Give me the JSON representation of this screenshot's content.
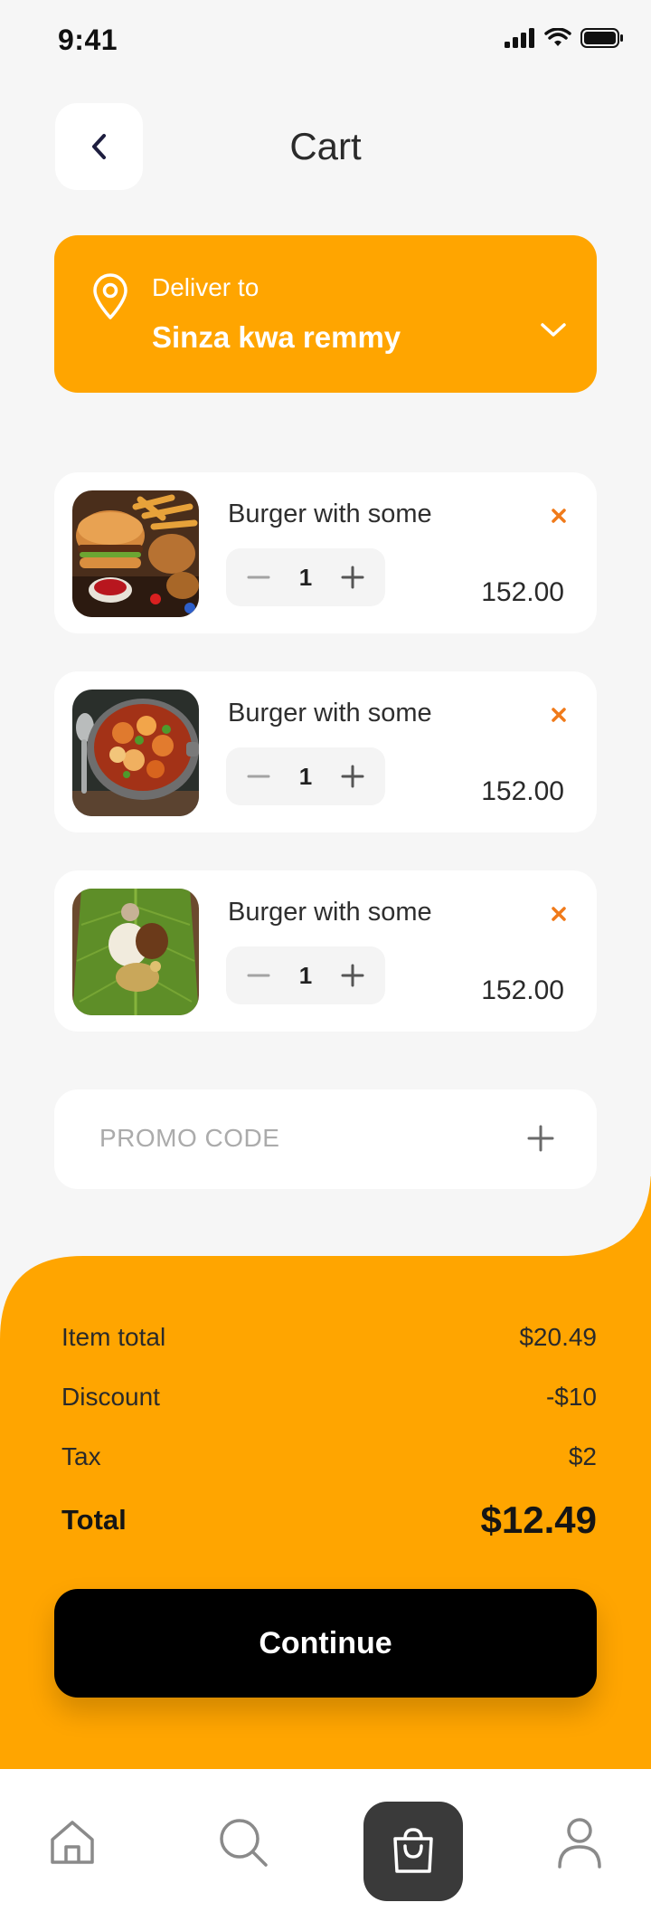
{
  "status_bar": {
    "time": "9:41"
  },
  "header": {
    "title": "Cart"
  },
  "delivery": {
    "label": "Deliver to",
    "address": "Sinza kwa remmy"
  },
  "cart": {
    "items": [
      {
        "name": "Burger with some",
        "quantity": "1",
        "price": "152.00"
      },
      {
        "name": "Burger with some",
        "quantity": "1",
        "price": "152.00"
      },
      {
        "name": "Burger with some",
        "quantity": "1",
        "price": "152.00"
      }
    ]
  },
  "promo": {
    "placeholder": "PROMO CODE"
  },
  "summary": {
    "item_total_label": "Item total",
    "item_total_value": "$20.49",
    "discount_label": "Discount",
    "discount_value": "-$10",
    "tax_label": "Tax",
    "tax_value": "$2",
    "total_label": "Total",
    "total_value": "$12.49"
  },
  "actions": {
    "continue_label": "Continue"
  },
  "tab_bar": {
    "items": [
      "home-icon",
      "search-icon",
      "bag-icon",
      "user-icon"
    ],
    "active": "bag-icon"
  },
  "colors": {
    "accent": "#FFA500",
    "remove": "#F07A1A",
    "dark": "#000000",
    "background": "#F6F6F6"
  }
}
